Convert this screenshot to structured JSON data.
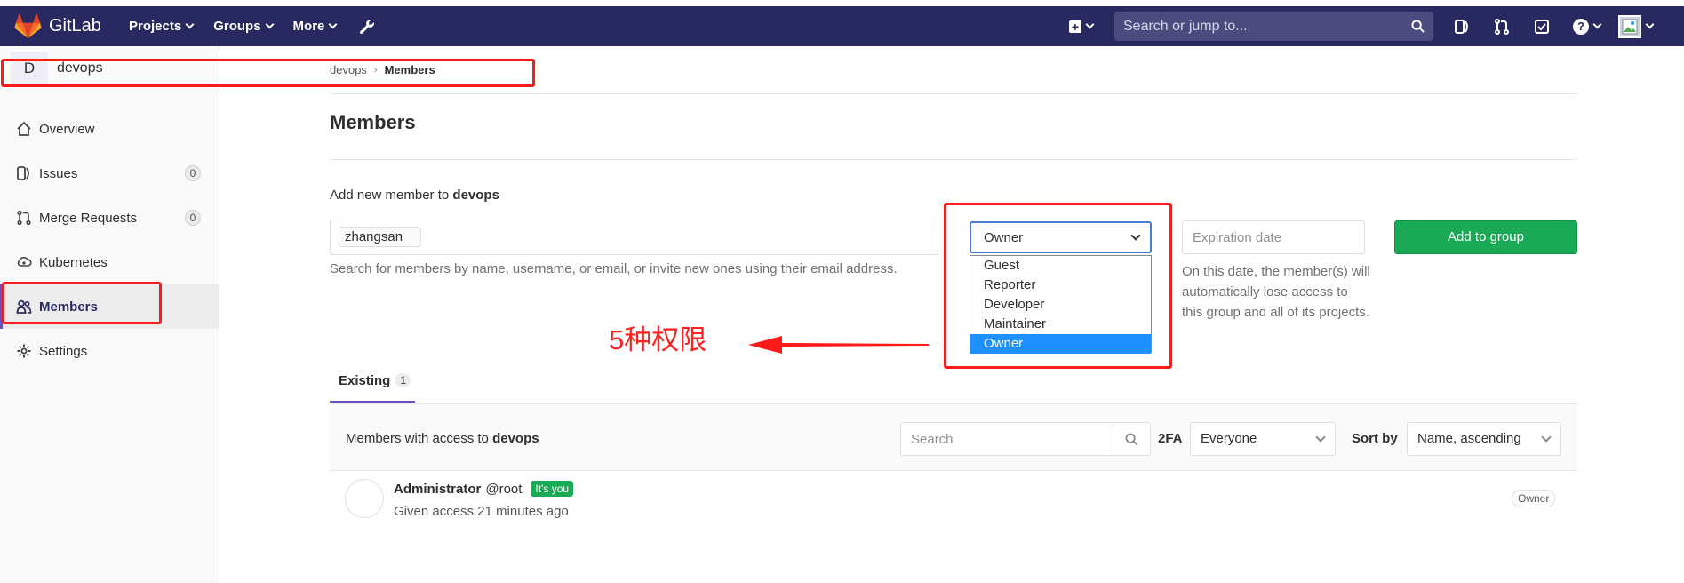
{
  "topnav": {
    "brand": "GitLab",
    "menu": [
      {
        "label": "Projects"
      },
      {
        "label": "Groups"
      },
      {
        "label": "More"
      }
    ],
    "search_placeholder": "Search or jump to..."
  },
  "sidebar": {
    "group_initial": "D",
    "group_name": "devops",
    "items": [
      {
        "label": "Overview",
        "icon": "home-icon"
      },
      {
        "label": "Issues",
        "icon": "issues-icon",
        "count": "0"
      },
      {
        "label": "Merge Requests",
        "icon": "merge-request-icon",
        "count": "0"
      },
      {
        "label": "Kubernetes",
        "icon": "kubernetes-icon"
      },
      {
        "label": "Members",
        "icon": "users-icon",
        "active": true
      },
      {
        "label": "Settings",
        "icon": "gear-icon"
      }
    ]
  },
  "breadcrumb": {
    "parent": "devops",
    "sep": "›",
    "current": "Members"
  },
  "page": {
    "title": "Members"
  },
  "add_member": {
    "label_prefix": "Add new member to",
    "group": "devops",
    "token": "zhangsan",
    "help": "Search for members by name, username, or email, or invite new ones using their email address.",
    "role_selected": "Owner",
    "role_options": [
      "Guest",
      "Reporter",
      "Developer",
      "Maintainer",
      "Owner"
    ],
    "expiration_placeholder": "Expiration date",
    "expiration_help": "On this date, the member(s) will automatically lose access to this group and all of its projects.",
    "button": "Add to group"
  },
  "annotation": {
    "text": "5种权限",
    "color": "#ff1a1a"
  },
  "tabs": {
    "existing_label": "Existing",
    "existing_count": "1"
  },
  "members_bar": {
    "text_prefix": "Members with access to",
    "group": "devops",
    "search_placeholder": "Search",
    "twofa_label": "2FA",
    "twofa_value": "Everyone",
    "sort_label": "Sort by",
    "sort_value": "Name, ascending"
  },
  "members": [
    {
      "name": "Administrator",
      "username": "@root",
      "badge": "It's you",
      "access": "Given access 21 minutes ago",
      "role": "Owner"
    }
  ],
  "colors": {
    "nav": "#292961",
    "accent": "#6b4fbb",
    "success": "#1aaa55",
    "select_highlight": "#1e90ff"
  }
}
